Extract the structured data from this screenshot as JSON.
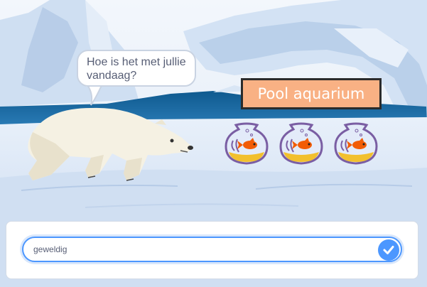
{
  "stage": {
    "speech_text": "Hoe is het met jullie vandaag?",
    "title_sign": "Pool aquarium",
    "colors": {
      "sign_background": "#f9b184",
      "sign_border": "#2b2b2b",
      "accent": "#4c97ff",
      "sky": "#eef4fb",
      "water": "#1b6aa3"
    },
    "sprites": {
      "character": "polar-bear",
      "bowls": [
        "goldfish-bowl",
        "goldfish-bowl",
        "goldfish-bowl"
      ]
    }
  },
  "ask_prompt": {
    "answer_value": "geweldig",
    "submit_icon": "check-icon"
  }
}
